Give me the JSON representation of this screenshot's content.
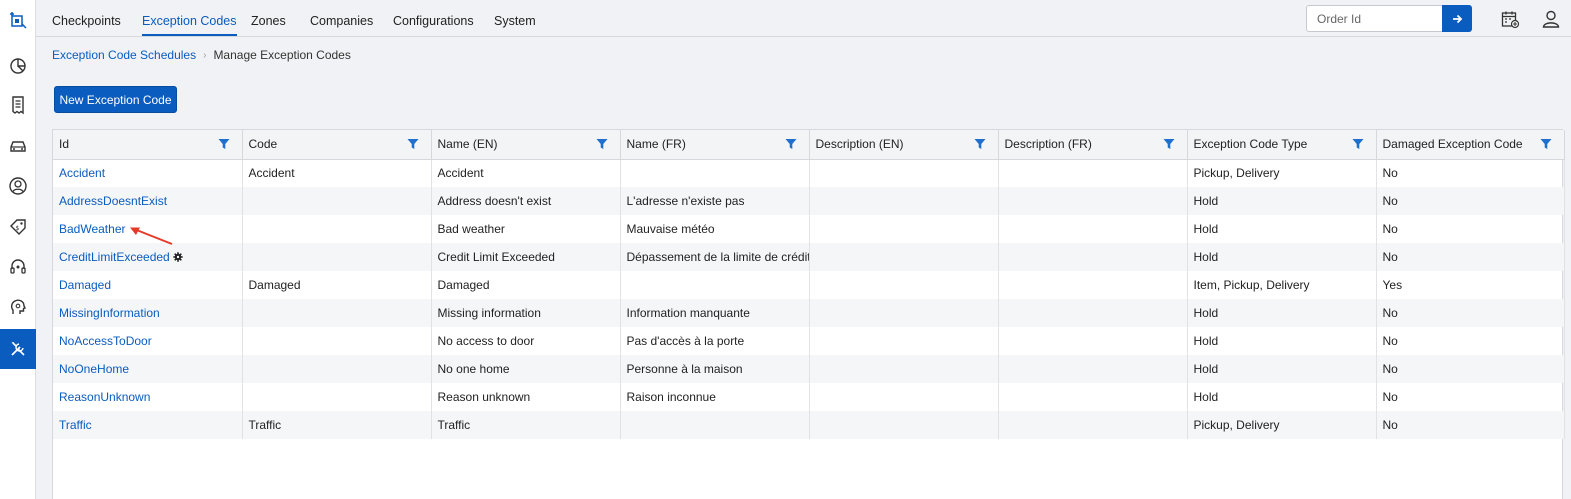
{
  "nav": {
    "tabs": [
      "Checkpoints",
      "Exception Codes",
      "Zones",
      "Companies",
      "Configurations",
      "System"
    ],
    "active_tab": "Exception Codes"
  },
  "search": {
    "placeholder": "Order Id"
  },
  "breadcrumb": {
    "parent": "Exception Code Schedules",
    "current": "Manage Exception Codes"
  },
  "actions": {
    "new_label": "New Exception Code"
  },
  "table": {
    "columns": [
      "Id",
      "Code",
      "Name (EN)",
      "Name (FR)",
      "Description (EN)",
      "Description (FR)",
      "Exception Code Type",
      "Damaged Exception Code"
    ],
    "rows": [
      [
        "Accident",
        "Accident",
        "Accident",
        "",
        "",
        "",
        "Pickup, Delivery",
        "No"
      ],
      [
        "AddressDoesntExist",
        "",
        "Address doesn't exist",
        "L'adresse n'existe pas",
        "",
        "",
        "Hold",
        "No"
      ],
      [
        "BadWeather",
        "",
        "Bad weather",
        "Mauvaise météo",
        "",
        "",
        "Hold",
        "No"
      ],
      [
        "CreditLimitExceeded",
        "",
        "Credit Limit Exceeded",
        "Dépassement de la limite de crédit",
        "",
        "",
        "Hold",
        "No"
      ],
      [
        "Damaged",
        "Damaged",
        "Damaged",
        "",
        "",
        "",
        "Item, Pickup, Delivery",
        "Yes"
      ],
      [
        "MissingInformation",
        "",
        "Missing information",
        "Information manquante",
        "",
        "",
        "Hold",
        "No"
      ],
      [
        "NoAccessToDoor",
        "",
        "No access to door",
        "Pas d'accès à la porte",
        "",
        "",
        "Hold",
        "No"
      ],
      [
        "NoOneHome",
        "",
        "No one home",
        "Personne à la maison",
        "",
        "",
        "Hold",
        "No"
      ],
      [
        "ReasonUnknown",
        "",
        "Reason unknown",
        "Raison inconnue",
        "",
        "",
        "Hold",
        "No"
      ],
      [
        "Traffic",
        "Traffic",
        "Traffic",
        "",
        "",
        "",
        "Pickup, Delivery",
        "No"
      ]
    ],
    "gear_row": "CreditLimitExceeded"
  },
  "colors": {
    "accent": "#0a5cbf",
    "annotation": "#e53a2a"
  }
}
